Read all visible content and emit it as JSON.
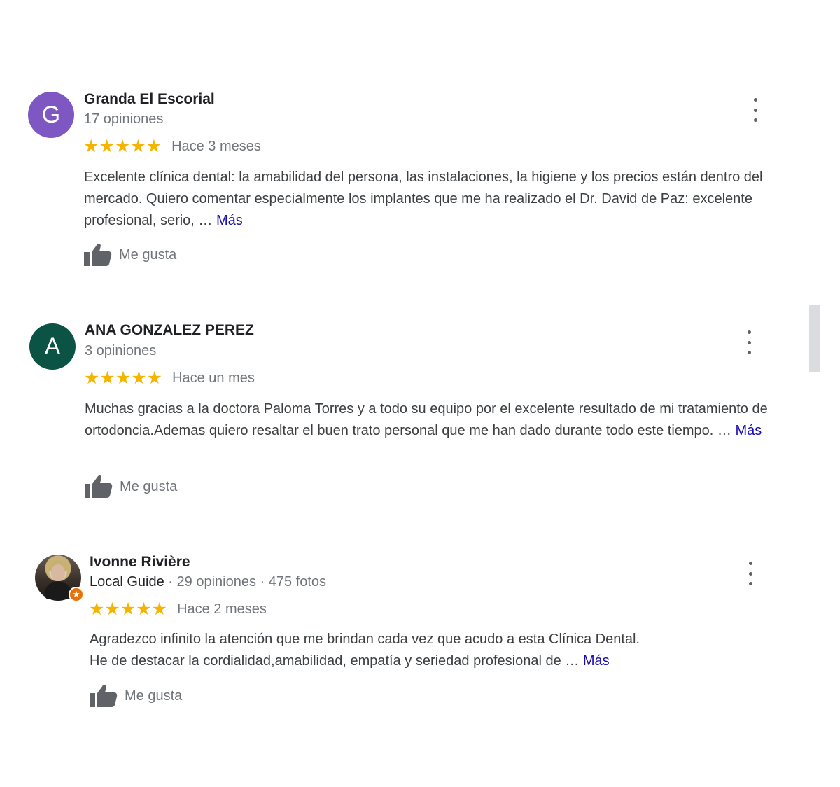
{
  "reviews": [
    {
      "initial": "G",
      "avatar_color": "#7e57c2",
      "name": "Granda El Escorial",
      "meta": "17 opiniones",
      "stars": "★★★★★",
      "rating": 5,
      "date": "Hace 3 meses",
      "text": "Excelente clínica dental: la amabilidad del persona, las instalaciones, la higiene y los precios están dentro del mercado. Quiero  comentar especialmente los implantes que me ha realizado el Dr. David de Paz: excelente profesional, serio, … ",
      "more": "Más",
      "like_label": "Me gusta",
      "menu_icon": "more-vert-icon"
    },
    {
      "initial": "A",
      "avatar_color": "#0b5345",
      "name": "ANA GONZALEZ PEREZ",
      "meta": "3 opiniones",
      "stars": "★★★★★",
      "rating": 5,
      "date": "Hace un mes",
      "text": "Muchas gracias a la doctora Paloma Torres y a todo su equipo por el excelente resultado de mi tratamiento de ortodoncia.Ademas quiero resaltar el buen trato personal que me han dado durante todo este tiempo. … ",
      "more": "Más",
      "like_label": "Me gusta",
      "menu_icon": "more-vert-icon"
    },
    {
      "name": "Ivonne Rivière",
      "guide_label": "Local Guide",
      "meta_separator": " · ",
      "meta_reviews": "29 opiniones",
      "meta_photos": "475 fotos",
      "badge_icon": "local-guide-star-icon",
      "stars": "★★★★★",
      "rating": 5,
      "date": "Hace 2 meses",
      "text_line1": "Agradezco infinito la atención que me brindan cada vez que acudo a esta Clínica Dental.",
      "text_line2": "He de destacar la cordialidad,amabilidad, empatía y seriedad  profesional de … ",
      "more": "Más",
      "like_label": "Me gusta",
      "menu_icon": "more-vert-icon"
    }
  ],
  "colors": {
    "star": "#f4b400",
    "link": "#1a0dab",
    "muted": "#70757a",
    "local_guide_badge": "#e8710a"
  }
}
